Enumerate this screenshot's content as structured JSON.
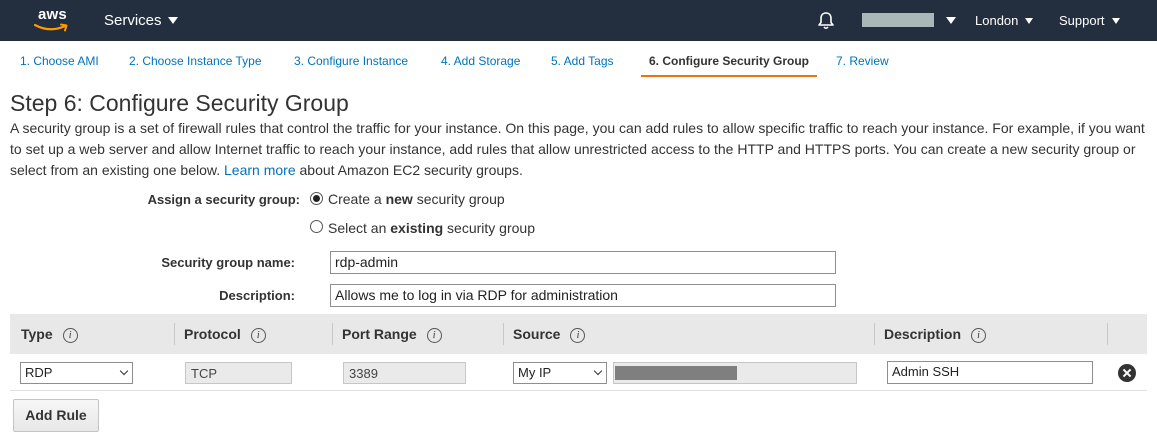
{
  "nav": {
    "logo": "aws",
    "services": "Services",
    "region": "London",
    "support": "Support"
  },
  "tabs": [
    {
      "label": "1. Choose AMI"
    },
    {
      "label": "2. Choose Instance Type"
    },
    {
      "label": "3. Configure Instance"
    },
    {
      "label": "4. Add Storage"
    },
    {
      "label": "5. Add Tags"
    },
    {
      "label": "6. Configure Security Group"
    },
    {
      "label": "7. Review"
    }
  ],
  "step": {
    "title": "Step 6: Configure Security Group",
    "intro_part1": "A security group is a set of firewall rules that control the traffic for your instance. On this page, you can add rules to allow specific traffic to reach your instance. For example, if you want to set up a web server and allow Internet traffic to reach your instance, add rules that allow unrestricted access to the HTTP and HTTPS ports. You can create a new security group or select from an existing one below.",
    "learn_more": "Learn more",
    "intro_part2": "about Amazon EC2 security groups."
  },
  "form": {
    "assign_label": "Assign a security group:",
    "option_create_pre": "Create a ",
    "option_create_bold": "new",
    "option_create_post": " security group",
    "option_select_pre": "Select an ",
    "option_select_bold": "existing",
    "option_select_post": " security group",
    "name_label": "Security group name:",
    "name_value": "rdp-admin",
    "desc_label": "Description:",
    "desc_value": "Allows me to log in via RDP for administration"
  },
  "table": {
    "headers": {
      "type": "Type",
      "protocol": "Protocol",
      "port_range": "Port Range",
      "source": "Source",
      "description": "Description"
    },
    "info_glyph": "i",
    "rows": [
      {
        "type": "RDP",
        "protocol": "TCP",
        "port_range": "3389",
        "source": "My IP",
        "description": "Admin SSH"
      }
    ]
  },
  "add_rule": "Add Rule"
}
